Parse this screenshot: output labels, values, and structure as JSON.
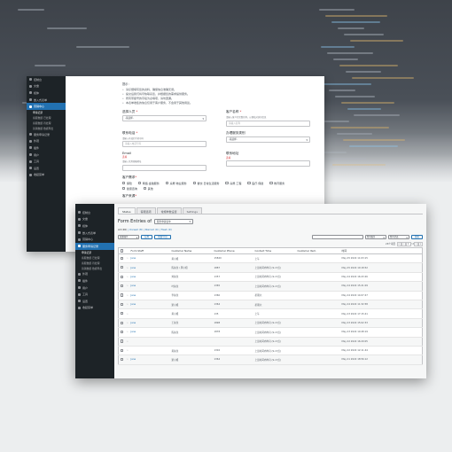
{
  "window1": {
    "sidebar": {
      "items": [
        {
          "label": "控制台"
        },
        {
          "label": "文章"
        },
        {
          "label": "媒体"
        },
        {
          "label": "嵌入式表单"
        },
        {
          "label": "营销中心",
          "active": true
        },
        {
          "label": "服务申请记录"
        },
        {
          "label": "外观"
        },
        {
          "label": "插件"
        },
        {
          "label": "用户"
        },
        {
          "label": "工具"
        },
        {
          "label": "设置"
        },
        {
          "label": "收起菜单"
        }
      ],
      "submenu": [
        "申请记录",
        "客服数据·已处理",
        "客服数据·待处理",
        "营销数据·数据导出"
      ]
    },
    "form": {
      "note_title": "提示：",
      "notes": [
        "请仔细填写您的资料，确保信息准确无误。",
        "提交后我们将尽快联系您，并根据您的需求提供服务。",
        "所有带星号的字段为必填项，请勿遗漏。",
        "本表单收集的信息仅用于客户服务，不会用于其他用途。"
      ],
      "fields": [
        {
          "label": "选择人员",
          "required": true,
          "hint": "",
          "value": "-请选择-",
          "select": true
        },
        {
          "label": "客户名称",
          "required": true,
          "hint": "请输入客户的完整名称，以便核对身份信息",
          "value": "请输入名称",
          "select": false
        },
        {
          "label": "联系电话",
          "required": true,
          "hint": "请输入有效的手机号码",
          "value": "请输入电话号码",
          "select": false
        },
        {
          "label": "办理服务类别",
          "required": false,
          "hint": "",
          "value": "-请选择-",
          "select": true
        },
        {
          "label": "Email",
          "required": false,
          "optional": "选填",
          "hint": "请输入常用邮箱地址",
          "value": "",
          "select": false
        },
        {
          "label": "联系地址",
          "required": false,
          "optional": "选填",
          "hint": "",
          "value": "",
          "select": false
        }
      ],
      "services_label": "客户需求",
      "services": [
        "保险",
        "网络·金融服务",
        "房屋·物业服务",
        "餐饮·日常生活服务",
        "房屋·工程",
        "医疗·保健",
        "教育服务",
        "健康咨询",
        "其他"
      ],
      "footer_label": "客户来源"
    }
  },
  "window2": {
    "sidebar": {
      "items": [
        {
          "label": "控制台"
        },
        {
          "label": "文章"
        },
        {
          "label": "媒体"
        },
        {
          "label": "嵌入式表单"
        },
        {
          "label": "营销中心"
        },
        {
          "label": "服务申请记录",
          "active": true
        },
        {
          "label": "外观"
        },
        {
          "label": "插件"
        },
        {
          "label": "用户"
        },
        {
          "label": "工具"
        },
        {
          "label": "设置"
        },
        {
          "label": "收起菜单"
        }
      ],
      "submenu": [
        "申请记录",
        "客服数据·已处理",
        "客服数据·待处理",
        "营销数据·数据导出"
      ]
    },
    "tabs": [
      "Status",
      "客服选项",
      "常规参数设置",
      "Settings"
    ],
    "page_title": "Form Entries of",
    "form_select": "服务申请表单",
    "subsub": {
      "all": "All",
      "all_count": "(26)",
      "unread": "Unread",
      "unread_count": "(8)",
      "starred": "Starred",
      "starred_count": "(0)",
      "trash": "Trash",
      "trash_count": "(0)"
    },
    "bulk_action": "批量操作",
    "apply_btn": "应用",
    "export_btn": "批量导出",
    "search_placeholder": "",
    "filter1": "所有服务",
    "filter2": "所有状态",
    "search_btn": "搜索",
    "pager_text": "26个项目",
    "pager_pages": [
      "«",
      "‹",
      "1",
      "/ 2",
      "›",
      "»"
    ],
    "columns": [
      "",
      "",
      "Form Staff",
      "Customer Name",
      "Customer Phone",
      "Contact Time",
      "Customer Item",
      "时间"
    ],
    "rows": [
      {
        "staff": "Jane",
        "name": "黄小姐",
        "phone": "15820",
        "contact": "上午",
        "item": "",
        "time": "May 25 2022 11:03:15"
      },
      {
        "staff": "Jane",
        "name": "陈先生 / 周小姐",
        "phone": "1887",
        "contact": "上班时间内均可 (9-17点)",
        "item": "",
        "time": "May 25 2022 10:18:52"
      },
      {
        "staff": "Jane",
        "name": "刘先生",
        "phone": "1357",
        "contact": "上班时间内均可 (9-17点)",
        "item": "",
        "time": "May 24 2022 16:43:26"
      },
      {
        "staff": "Jane",
        "name": "叶先生",
        "phone": "1365",
        "contact": "上班时间内均可 (9-17点)",
        "item": "",
        "time": "May 24 2022 15:21:09"
      },
      {
        "staff": "Jane",
        "name": "李先生",
        "phone": "1360",
        "contact": "星期六",
        "item": "",
        "time": "May 24 2022 14:07:47"
      },
      {
        "staff": "Jane",
        "name": "梁小姐",
        "phone": "1364",
        "contact": "星期六",
        "item": "",
        "time": "May 24 2022 11:32:58"
      },
      {
        "staff": "",
        "name": "黄小姐",
        "phone": "135",
        "contact": "上午",
        "item": "",
        "time": "May 23 2022 17:15:41"
      },
      {
        "staff": "Jane",
        "name": "王先生",
        "phone": "1898",
        "contact": "上班时间内均可 (9-17点)",
        "item": "",
        "time": "May 23 2022 15:02:33"
      },
      {
        "staff": "Jane",
        "name": "陈先生",
        "phone": "1878",
        "contact": "上班时间内均可 (9-17点)",
        "item": "",
        "time": "May 23 2022 10:48:19"
      },
      {
        "staff": "",
        "name": "",
        "phone": "",
        "contact": "上班时间内均可 (9-17点)",
        "item": "",
        "time": "May 22 2022 16:29:05"
      },
      {
        "staff": "",
        "name": "黄先生",
        "phone": "1302",
        "contact": "上班时间内均可 (9-17点)",
        "item": "",
        "time": "May 22 2022 12:11:44"
      },
      {
        "staff": "Jane",
        "name": "梁小姐",
        "phone": "1364",
        "contact": "上班时间内均可 (9-17点)",
        "item": "",
        "time": "May 21 2022 18:56:12"
      }
    ]
  }
}
